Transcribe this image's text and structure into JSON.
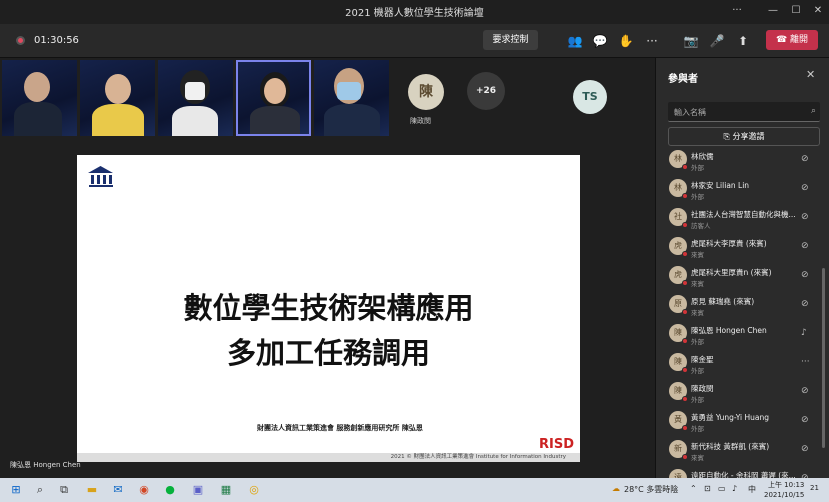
{
  "window": {
    "title": "2021 機器人數位學生技術論壇",
    "minimize": "—",
    "maximize": "☐",
    "close": "✕",
    "more": "···"
  },
  "toolbar": {
    "timer": "01:30:56",
    "request_control": "要求控制",
    "leave": "離開",
    "icons": {
      "people": "👥",
      "chat": "💬",
      "reactions": "✋",
      "more": "···",
      "camera": "📷",
      "mic": "🎤",
      "share": "⬆",
      "leave_phone": "☎"
    }
  },
  "participants_strip": {
    "extra_count": "+26",
    "chen_initial": "陳",
    "chen_name": "陳政閔",
    "ts_initials": "TS"
  },
  "slide": {
    "title_line1": "數位學生技術架構應用",
    "title_line2": "多加工任務調用",
    "author": "財團法人資訊工業策進會 服務創新應用研究所 陳弘恩",
    "footer": "2021 © 財團法人資訊工業策進會 Institute for Information Industry",
    "brand": "RISD"
  },
  "presenter_label": "陳弘恩 Hongen Chen",
  "panel": {
    "title": "參與者",
    "search_placeholder": "輸入名稱",
    "share_invite": "分享邀請",
    "participants": [
      {
        "initial": "林",
        "name": "林欣儒",
        "role": "外部",
        "mic": "muted"
      },
      {
        "initial": "林",
        "name": "林家安 Lilian Lin",
        "role": "外部",
        "mic": "muted"
      },
      {
        "initial": "社",
        "name": "社團法人台灣智慧自動化與機...",
        "role": "訪客人",
        "mic": "muted"
      },
      {
        "initial": "虎",
        "name": "虎尾科大李厚貴 (來賓)",
        "role": "來賓",
        "mic": "muted"
      },
      {
        "initial": "虎",
        "name": "虎尾科大里厚貴n (來賓)",
        "role": "來賓",
        "mic": "muted"
      },
      {
        "initial": "原",
        "name": "原見 蘇瑞堯 (來賓)",
        "role": "來賓",
        "mic": "muted"
      },
      {
        "initial": "陳",
        "name": "陳弘恩 Hongen Chen",
        "role": "外部",
        "mic": "on"
      },
      {
        "initial": "陳",
        "name": "陳金聖",
        "role": "外部",
        "mic": "more"
      },
      {
        "initial": "陳",
        "name": "陳政閔",
        "role": "外部",
        "mic": "muted"
      },
      {
        "initial": "黃",
        "name": "黃勇益 Yung-Yi Huang",
        "role": "外部",
        "mic": "muted"
      },
      {
        "initial": "新",
        "name": "新代科技 黃群凱 (來賓)",
        "role": "來賓",
        "mic": "muted"
      },
      {
        "initial": "遠",
        "name": "遠距自動化 - 余科岡 蕭遲 (來...",
        "role": "",
        "mic": "muted"
      }
    ]
  },
  "taskbar": {
    "weather": "28°C 多雲時陰",
    "ime": "中",
    "time": "上午 10:13",
    "date": "2021/10/15",
    "notification": "21"
  }
}
